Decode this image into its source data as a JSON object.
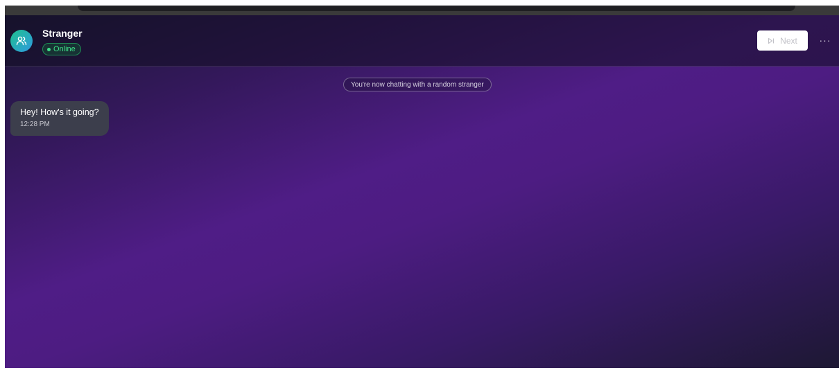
{
  "header": {
    "name": "Stranger",
    "status": "Online",
    "next_label": "Next",
    "more_label": "···"
  },
  "system_message": "You're now chatting with a random stranger",
  "messages": [
    {
      "sender": "stranger",
      "text": "Hey! How's it going?",
      "time": "12:28 PM"
    }
  ],
  "icons": {
    "avatar": "users-icon",
    "next": "skip-forward-icon",
    "more": "ellipsis-icon"
  },
  "colors": {
    "status_green": "#3ee088",
    "bubble": "#3c3e4c",
    "avatar_start": "#1fbf8f",
    "avatar_end": "#2f9be0"
  }
}
